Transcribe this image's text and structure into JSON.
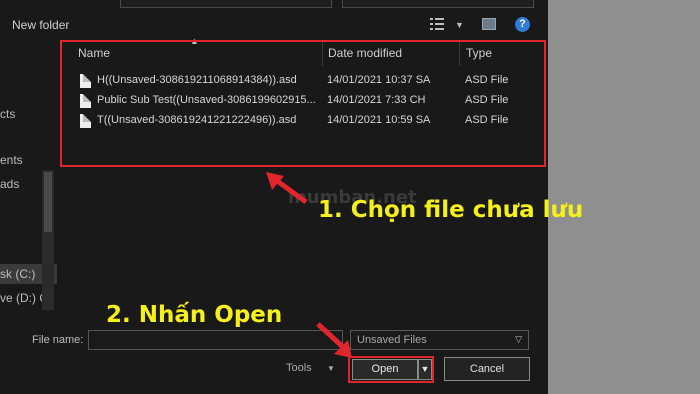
{
  "toolbar": {
    "folder_button": "New folder"
  },
  "navigation": {
    "items": [
      "cts",
      "ents",
      "ads",
      "sk (C:)",
      "ve (D:) O"
    ]
  },
  "file_list": {
    "columns": [
      "Name",
      "Date modified",
      "Type"
    ],
    "rows": [
      {
        "name": "H((Unsaved-308619211068914384)).asd",
        "date": "14/01/2021 10:37 SA",
        "type": "ASD File"
      },
      {
        "name": "Public Sub Test((Unsaved-3086199602915...",
        "date": "14/01/2021 7:33 CH",
        "type": "ASD File"
      },
      {
        "name": "T((Unsaved-308619241221222496)).asd",
        "date": "14/01/2021 10:59 SA",
        "type": "ASD File"
      }
    ]
  },
  "bottom": {
    "file_name_label": "File name:",
    "file_name_value": "",
    "file_type_selected": "Unsaved Files",
    "tools_label": "Tools",
    "open_label": "Open",
    "cancel_label": "Cancel"
  },
  "annotations": {
    "step1": "1. Chọn file chưa lưu",
    "step2": "2. Nhấn Open",
    "watermark": "mumban.net",
    "highlight_color": "#e0262c",
    "caption_color": "#f5f01a"
  },
  "icons": [
    "view-options-icon",
    "chevron-down-icon",
    "preview-pane-icon",
    "help-icon",
    "file-icon",
    "sort-up-icon",
    "dropdown-arrow-icon"
  ]
}
